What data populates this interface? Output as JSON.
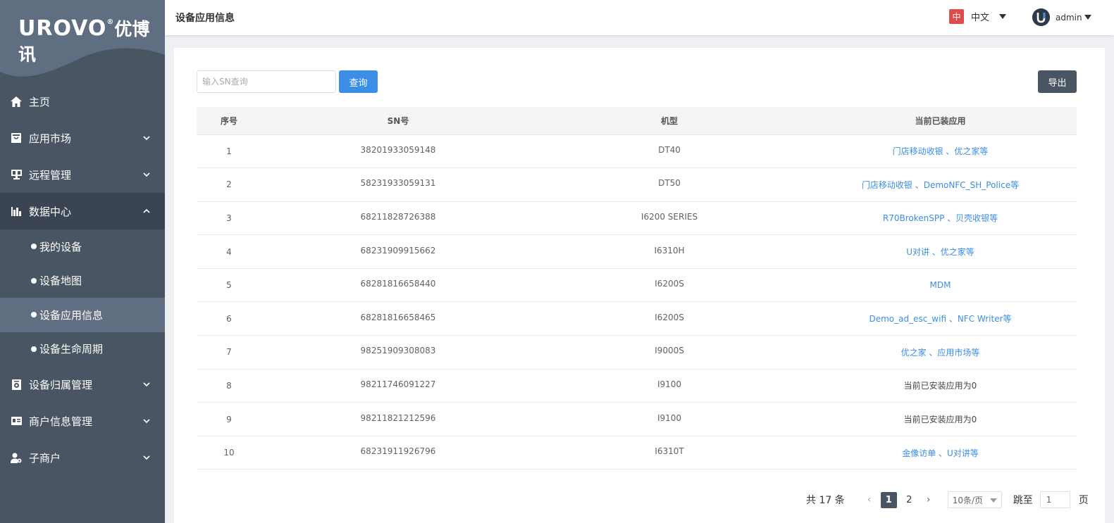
{
  "brand": {
    "logo_text": "UROVO",
    "logo_cn": "优博讯"
  },
  "sidebar": {
    "items": [
      {
        "label": "主页",
        "icon": "home-icon"
      },
      {
        "label": "应用市场",
        "icon": "store-icon"
      },
      {
        "label": "远程管理",
        "icon": "remote-icon"
      },
      {
        "label": "数据中心",
        "icon": "chart-icon"
      },
      {
        "label": "设备归属管理",
        "icon": "device-icon"
      },
      {
        "label": "商户信息管理",
        "icon": "id-card-icon"
      },
      {
        "label": "子商户",
        "icon": "user-gear-icon"
      }
    ],
    "sub_items": [
      {
        "label": "我的设备"
      },
      {
        "label": "设备地图"
      },
      {
        "label": "设备应用信息"
      },
      {
        "label": "设备生命周期"
      }
    ]
  },
  "header": {
    "title": "设备应用信息",
    "lang_badge": "中",
    "lang_label": "中文",
    "user_name": "admin"
  },
  "search": {
    "placeholder": "输入SN查询",
    "button": "查询"
  },
  "export_button": "导出",
  "table": {
    "columns": [
      "序号",
      "SN号",
      "机型",
      "当前已装应用"
    ],
    "rows": [
      {
        "no": "1",
        "sn": "38201933059148",
        "model": "DT40",
        "apps": "门店移动收银 、优之家等"
      },
      {
        "no": "2",
        "sn": "58231933059131",
        "model": "DT50",
        "apps": "门店移动收银 、DemoNFC_SH_Police等"
      },
      {
        "no": "3",
        "sn": "68211828726388",
        "model": "I6200 SERIES",
        "apps": "R70BrokenSPP 、贝壳收银等"
      },
      {
        "no": "4",
        "sn": "68231909915662",
        "model": "I6310H",
        "apps": "U对讲 、优之家等"
      },
      {
        "no": "5",
        "sn": "68281816658440",
        "model": "I6200S",
        "apps": "MDM"
      },
      {
        "no": "6",
        "sn": "68281816658465",
        "model": "I6200S",
        "apps": "Demo_ad_esc_wifi 、NFC Writer等"
      },
      {
        "no": "7",
        "sn": "98251909308083",
        "model": "I9000S",
        "apps": "优之家 、应用市场等"
      },
      {
        "no": "8",
        "sn": "98211746091227",
        "model": "I9100",
        "apps": "当前已安装应用为0"
      },
      {
        "no": "9",
        "sn": "98211821212596",
        "model": "I9100",
        "apps": "当前已安装应用为0"
      },
      {
        "no": "10",
        "sn": "68231911926796",
        "model": "I6310T",
        "apps": "金像访单 、U对讲等"
      }
    ]
  },
  "pagination": {
    "total": "共 17 条",
    "pages": [
      "1",
      "2"
    ],
    "current": "1",
    "page_size": "10条/页",
    "goto_label": "跳至",
    "goto_value": "1",
    "page_unit": "页"
  },
  "colors": {
    "sidebar": "#4a5563",
    "sidebar_active": "#5f6e80",
    "accent": "#3a8ee6",
    "lang_badge": "#e04b4b"
  }
}
